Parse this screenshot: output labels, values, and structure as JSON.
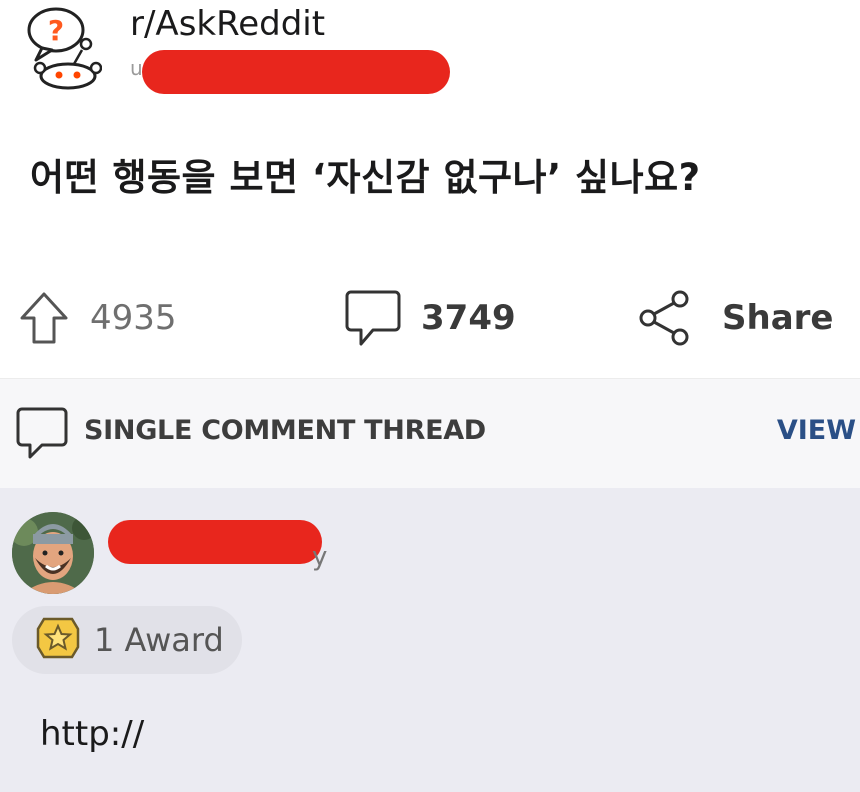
{
  "post": {
    "subreddit": "r/AskReddit",
    "user_prefix": "u",
    "title": "어떤 행동을 보면 ‘자신감 없구나’ 싶나요?"
  },
  "actions": {
    "upvotes": "4935",
    "comments": "3749",
    "share_label": "Share"
  },
  "thread_bar": {
    "label": "SINGLE COMMENT THREAD",
    "view_label": "VIEW"
  },
  "comment": {
    "username_tail": "y",
    "awards_label": "1 Award",
    "body": "http://"
  },
  "colors": {
    "redaction": "#e8261d",
    "view_link": "#2a4f86",
    "comment_bg": "#ebebf2"
  },
  "icons": [
    "subreddit-avatar-icon",
    "upvote-icon",
    "comment-icon",
    "share-icon",
    "comment-thread-icon",
    "award-icon"
  ]
}
